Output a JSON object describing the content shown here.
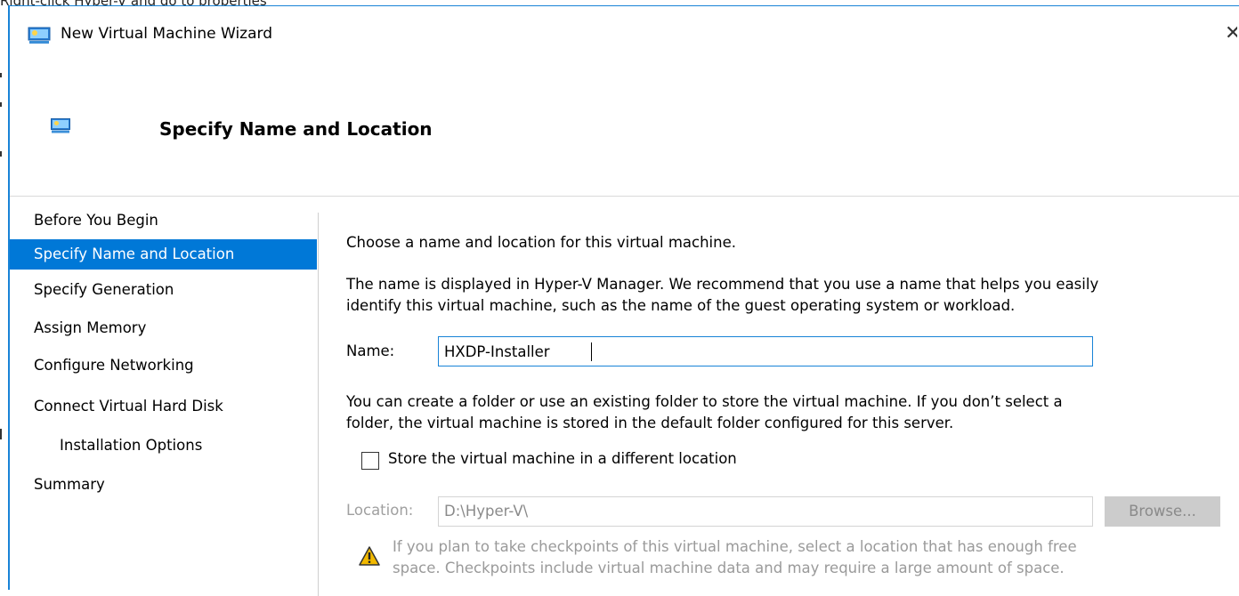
{
  "background_title": "Right-click Hyper-V and go to properties",
  "window": {
    "title": "New Virtual Machine Wizard",
    "close_glyph": "✕",
    "accent_color": "#0078d7"
  },
  "header": {
    "title": "Specify Name and Location"
  },
  "nav": {
    "items": [
      {
        "label": "Before You Begin"
      },
      {
        "label": "Specify Name and Location",
        "active": true
      },
      {
        "label": "Specify Generation"
      },
      {
        "label": "Assign Memory"
      },
      {
        "label": "Configure Networking"
      },
      {
        "label": "Connect Virtual Hard Disk"
      },
      {
        "label": "Installation Options",
        "indent": true
      },
      {
        "label": "Summary"
      }
    ]
  },
  "content": {
    "intro": "Choose a name and location for this virtual machine.",
    "description_line1": "The name is displayed in Hyper-V Manager. We recommend that you use a name that helps you easily",
    "description_line2": "identify this virtual machine, such as the name of the guest operating system or workload.",
    "name_label": "Name:",
    "name_value": "HXDP-Installer",
    "folder_line1": "You can create a folder or use an existing folder to store the virtual machine. If you don’t select a",
    "folder_line2": "folder, the virtual machine is stored in the default folder configured for this server.",
    "checkbox_label": "Store the virtual machine in a different location",
    "checkbox_checked": false,
    "location_label": "Location:",
    "location_value": "D:\\Hyper-V\\",
    "browse_label": "Browse...",
    "warning_line1": "If you plan to take checkpoints of this virtual machine, select a location that has enough free",
    "warning_line2": "space. Checkpoints include virtual machine data and may require a large amount of space.",
    "icons": {
      "title": "virtual-machine-icon",
      "header": "virtual-machine-icon",
      "warning": "warning-icon"
    }
  }
}
